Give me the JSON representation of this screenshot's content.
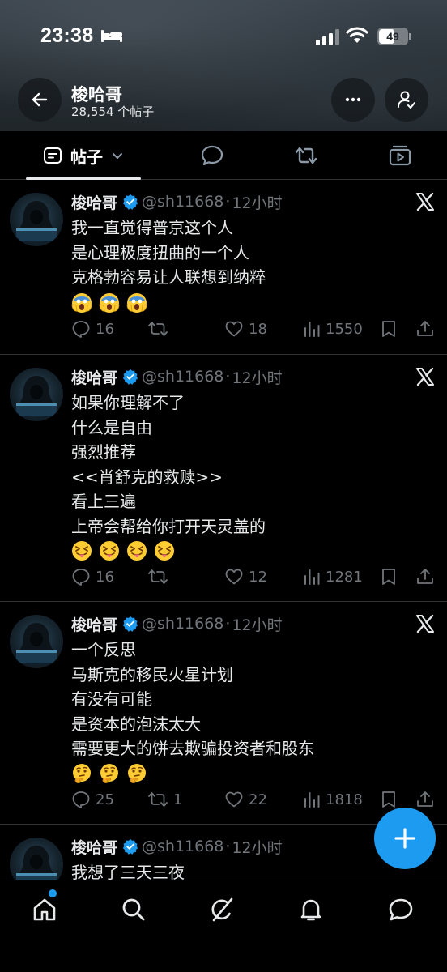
{
  "status_bar": {
    "time": "23:38",
    "battery_level": "49",
    "icons": [
      "bed-icon",
      "cellular-signal-icon",
      "wifi-icon",
      "battery-icon"
    ]
  },
  "header": {
    "name": "梭哈哥",
    "post_count": "28,554 个帖子",
    "icons": [
      "back-arrow-icon",
      "more-options-icon",
      "follow-user-icon"
    ]
  },
  "tabs": {
    "posts_label": "帖子",
    "icons": [
      "posts-icon",
      "chevron-down-icon",
      "replies-icon",
      "reposts-icon",
      "media-icon"
    ]
  },
  "posts": [
    {
      "name": "梭哈哥",
      "handle": "@sh11668",
      "dot": "·",
      "time": "12小时",
      "lines": [
        "我一直觉得普京这个人",
        "是心理极度扭曲的一个人",
        "克格勃容易让人联想到纳粹"
      ],
      "emojis": [
        "scream-emoji",
        "scream-emoji",
        "scream-emoji"
      ],
      "replies": "16",
      "reposts": "",
      "likes": "18",
      "views": "1550"
    },
    {
      "name": "梭哈哥",
      "handle": "@sh11668",
      "dot": "·",
      "time": "12小时",
      "lines": [
        "如果你理解不了",
        "什么是自由",
        "强烈推荐",
        "<<肖舒克的救赎>>",
        "看上三遍",
        "上帝会帮给你打开天灵盖的"
      ],
      "emojis": [
        "squinting-tongue-emoji",
        "squinting-tongue-emoji",
        "squinting-tongue-emoji",
        "squinting-tongue-emoji"
      ],
      "replies": "16",
      "reposts": "",
      "likes": "12",
      "views": "1281"
    },
    {
      "name": "梭哈哥",
      "handle": "@sh11668",
      "dot": "·",
      "time": "12小时",
      "lines": [
        "一个反思",
        "马斯克的移民火星计划",
        "有没有可能",
        "是资本的泡沫太大",
        "需要更大的饼去欺骗投资者和股东"
      ],
      "emojis": [
        "thinking-emoji",
        "thinking-emoji",
        "thinking-emoji"
      ],
      "replies": "25",
      "reposts": "1",
      "likes": "22",
      "views": "1818"
    },
    {
      "name": "梭哈哥",
      "handle": "@sh11668",
      "dot": "·",
      "time": "12小时",
      "lines": [
        "我想了三天三夜"
      ],
      "emojis": []
    }
  ],
  "fab": {
    "icon": "plus-icon"
  },
  "bottom_nav": {
    "items": [
      "home-icon",
      "search-icon",
      "grok-icon",
      "notifications-icon",
      "messages-icon"
    ]
  },
  "colors": {
    "accent": "#1d9bf0",
    "background": "#000000",
    "text": "#e7e9ea",
    "muted": "#71767b",
    "divider": "#2f3336"
  }
}
